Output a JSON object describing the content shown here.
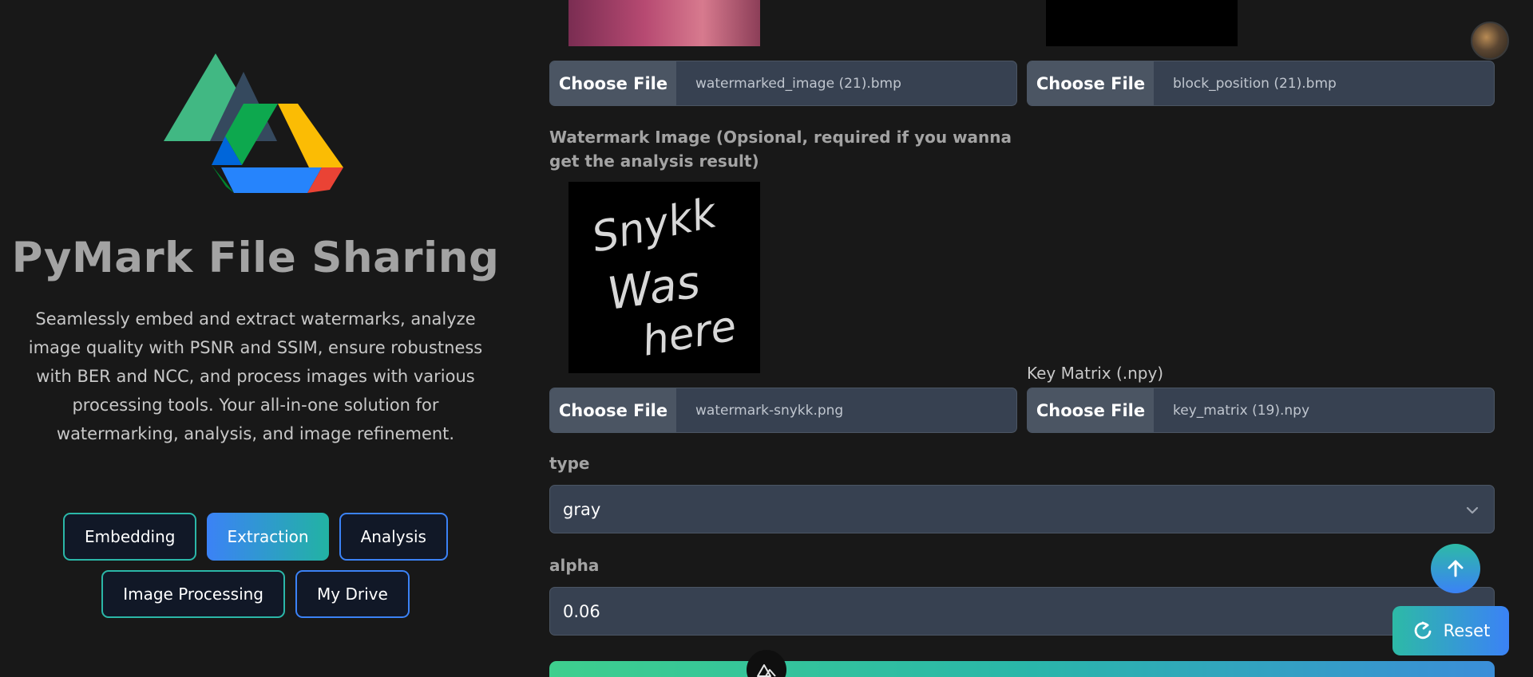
{
  "sidebar": {
    "app_title": "PyMark File Sharing",
    "description": "Seamlessly embed and extract watermarks, analyze image quality with PSNR and SSIM, ensure robustness with BER and NCC, and process images with various processing tools. Your all-in-one solution for watermarking, analysis, and image refinement.",
    "nav": [
      {
        "label": "Embedding",
        "active": false
      },
      {
        "label": "Extraction",
        "active": true
      },
      {
        "label": "Analysis",
        "active": false
      },
      {
        "label": "Image Processing",
        "active": false
      },
      {
        "label": "My Drive",
        "active": false
      }
    ]
  },
  "form": {
    "watermarked_file": {
      "button": "Choose File",
      "file_name": "watermarked_image (21).bmp"
    },
    "block_position_file": {
      "button": "Choose File",
      "file_name": "block_position (21).bmp"
    },
    "watermark_image": {
      "label": "Watermark Image (Opsional, required if you wanna get the analysis result)",
      "preview_text": [
        "Snykk",
        "Was",
        "here"
      ],
      "button": "Choose File",
      "file_name": "watermark-snykk.png"
    },
    "key_matrix": {
      "label": "Key Matrix (.npy)",
      "button": "Choose File",
      "file_name": "key_matrix (19).npy"
    },
    "type": {
      "label": "type",
      "value": "gray"
    },
    "alpha": {
      "label": "alpha",
      "value": "0.06"
    }
  },
  "floating": {
    "reset_label": "Reset"
  },
  "icons": {
    "logo": "google-drive-logo-icon",
    "scroll_top": "arrow-up-icon",
    "reset": "refresh-icon",
    "select": "chevron-down-icon",
    "badge": "nuxt-icon"
  },
  "colors": {
    "background": "#181818",
    "accent_teal": "#2bb7a8",
    "accent_blue": "#3b82f6",
    "input_bg": "#374151"
  }
}
